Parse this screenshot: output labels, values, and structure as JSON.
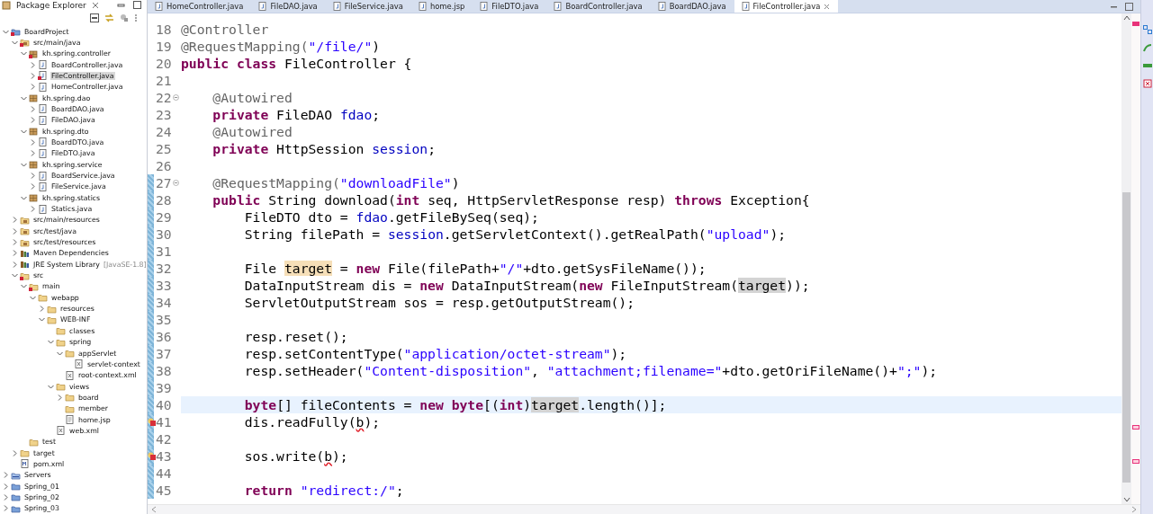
{
  "explorer": {
    "title": "Package Explorer",
    "tree": [
      {
        "label": "BoardProject",
        "kind": "project",
        "expanded": true,
        "error": true,
        "selected": false,
        "children": [
          {
            "label": "src/main/java",
            "kind": "source",
            "expanded": true,
            "error": true,
            "selected": false,
            "children": [
              {
                "label": "kh.spring.controller",
                "kind": "package",
                "expanded": true,
                "error": true,
                "selected": false,
                "children": [
                  {
                    "label": "BoardController.java",
                    "kind": "java",
                    "expanded": false,
                    "selected": false
                  },
                  {
                    "label": "FileController.java",
                    "kind": "java",
                    "expanded": false,
                    "error": true,
                    "selected": true
                  },
                  {
                    "label": "HomeController.java",
                    "kind": "java",
                    "expanded": false,
                    "selected": false
                  }
                ]
              },
              {
                "label": "kh.spring.dao",
                "kind": "package",
                "expanded": true,
                "selected": false,
                "children": [
                  {
                    "label": "BoardDAO.java",
                    "kind": "java",
                    "expanded": false,
                    "selected": false
                  },
                  {
                    "label": "FileDAO.java",
                    "kind": "java",
                    "expanded": false,
                    "selected": false
                  }
                ]
              },
              {
                "label": "kh.spring.dto",
                "kind": "package",
                "expanded": true,
                "selected": false,
                "children": [
                  {
                    "label": "BoardDTO.java",
                    "kind": "java",
                    "expanded": false,
                    "selected": false
                  },
                  {
                    "label": "FileDTO.java",
                    "kind": "java",
                    "expanded": false,
                    "selected": false
                  }
                ]
              },
              {
                "label": "kh.spring.service",
                "kind": "package",
                "expanded": true,
                "selected": false,
                "children": [
                  {
                    "label": "BoardService.java",
                    "kind": "java",
                    "expanded": false,
                    "selected": false
                  },
                  {
                    "label": "FileService.java",
                    "kind": "java",
                    "expanded": false,
                    "selected": false
                  }
                ]
              },
              {
                "label": "kh.spring.statics",
                "kind": "package",
                "expanded": true,
                "selected": false,
                "children": [
                  {
                    "label": "Statics.java",
                    "kind": "java",
                    "expanded": false,
                    "selected": false
                  }
                ]
              }
            ]
          },
          {
            "label": "src/main/resources",
            "kind": "source",
            "expanded": false,
            "selected": false
          },
          {
            "label": "src/test/java",
            "kind": "source",
            "expanded": false,
            "selected": false
          },
          {
            "label": "src/test/resources",
            "kind": "source",
            "expanded": false,
            "selected": false
          },
          {
            "label": "Maven Dependencies",
            "kind": "library",
            "expanded": false,
            "selected": false
          },
          {
            "label": "JRE System Library",
            "suffix": "[JavaSE-1.8]",
            "kind": "library",
            "expanded": false,
            "selected": false
          },
          {
            "label": "src",
            "kind": "folder",
            "expanded": true,
            "error": true,
            "selected": false,
            "children": [
              {
                "label": "main",
                "kind": "folder",
                "expanded": true,
                "error": true,
                "selected": false,
                "children": [
                  {
                    "label": "webapp",
                    "kind": "folder",
                    "expanded": true,
                    "selected": false,
                    "children": [
                      {
                        "label": "resources",
                        "kind": "folder",
                        "expanded": false,
                        "selected": false
                      },
                      {
                        "label": "WEB-INF",
                        "kind": "folder",
                        "expanded": true,
                        "selected": false,
                        "children": [
                          {
                            "label": "classes",
                            "kind": "folder",
                            "selected": false
                          },
                          {
                            "label": "spring",
                            "kind": "folder",
                            "expanded": true,
                            "selected": false,
                            "children": [
                              {
                                "label": "appServlet",
                                "kind": "folder",
                                "expanded": true,
                                "selected": false,
                                "children": [
                                  {
                                    "label": "servlet-context",
                                    "kind": "xml",
                                    "selected": false
                                  }
                                ]
                              },
                              {
                                "label": "root-context.xml",
                                "kind": "xml",
                                "selected": false
                              }
                            ]
                          },
                          {
                            "label": "views",
                            "kind": "folder",
                            "expanded": true,
                            "selected": false,
                            "children": [
                              {
                                "label": "board",
                                "kind": "folder",
                                "expanded": false,
                                "selected": false
                              },
                              {
                                "label": "member",
                                "kind": "folder",
                                "selected": false
                              },
                              {
                                "label": "home.jsp",
                                "kind": "jsp",
                                "selected": false
                              }
                            ]
                          },
                          {
                            "label": "web.xml",
                            "kind": "xml",
                            "selected": false
                          }
                        ]
                      }
                    ]
                  }
                ]
              },
              {
                "label": "test",
                "kind": "folder",
                "selected": false
              }
            ]
          },
          {
            "label": "target",
            "kind": "folder",
            "expanded": false,
            "selected": false
          },
          {
            "label": "pom.xml",
            "kind": "pom",
            "selected": false
          }
        ]
      },
      {
        "label": "Servers",
        "kind": "servers",
        "expanded": false,
        "selected": false
      },
      {
        "label": "Spring_01",
        "kind": "project",
        "expanded": false,
        "selected": false
      },
      {
        "label": "Spring_02",
        "kind": "project",
        "expanded": false,
        "selected": false
      },
      {
        "label": "Spring_03",
        "kind": "project",
        "expanded": false,
        "selected": false
      }
    ]
  },
  "tabs": [
    {
      "label": "HomeController.java",
      "selected": false
    },
    {
      "label": "FileDAO.java",
      "selected": false
    },
    {
      "label": "FileService.java",
      "selected": false
    },
    {
      "label": "home.jsp",
      "selected": false
    },
    {
      "label": "FileDTO.java",
      "selected": false
    },
    {
      "label": "BoardController.java",
      "selected": false
    },
    {
      "label": "BoardDAO.java",
      "selected": false
    },
    {
      "label": "FileController.java",
      "selected": true
    }
  ],
  "lines": [
    {
      "num": "18",
      "changed": false,
      "tokens": [
        {
          "text": "@Controller",
          "kind": "ann"
        }
      ]
    },
    {
      "num": "19",
      "changed": false,
      "tokens": [
        {
          "text": "@RequestMapping(",
          "kind": "ann"
        },
        {
          "text": "\"/file/\"",
          "kind": "str"
        },
        {
          "text": ")",
          "kind": "p"
        }
      ]
    },
    {
      "num": "20",
      "changed": false,
      "tokens": [
        {
          "text": "public class",
          "kind": "kw"
        },
        {
          "text": " FileController {",
          "kind": "p"
        }
      ]
    },
    {
      "num": "21",
      "changed": false
    },
    {
      "num": "22",
      "changed": false,
      "fold": true,
      "tokens": [
        {
          "text": "    @Autowired",
          "kind": "ann"
        }
      ]
    },
    {
      "num": "23",
      "changed": false,
      "tokens": [
        {
          "text": "    private",
          "kind": "kw"
        },
        {
          "text": " FileDAO ",
          "kind": "p"
        },
        {
          "text": "fdao",
          "kind": "fld"
        },
        {
          "text": ";",
          "kind": "p"
        }
      ]
    },
    {
      "num": "24",
      "changed": false,
      "tokens": [
        {
          "text": "    @Autowired",
          "kind": "ann"
        }
      ]
    },
    {
      "num": "25",
      "changed": false,
      "tokens": [
        {
          "text": "    private",
          "kind": "kw"
        },
        {
          "text": " HttpSession ",
          "kind": "p"
        },
        {
          "text": "session",
          "kind": "fld"
        },
        {
          "text": ";",
          "kind": "p"
        }
      ]
    },
    {
      "num": "26",
      "changed": false
    },
    {
      "num": "27",
      "changed": true,
      "fold": true,
      "tokens": [
        {
          "text": "    @RequestMapping(",
          "kind": "ann"
        },
        {
          "text": "\"downloadFile\"",
          "kind": "str"
        },
        {
          "text": ")",
          "kind": "p"
        }
      ]
    },
    {
      "num": "28",
      "changed": true,
      "tokens": [
        {
          "text": "    public",
          "kind": "kw"
        },
        {
          "text": " String download(",
          "kind": "p"
        },
        {
          "text": "int",
          "kind": "kw"
        },
        {
          "text": " seq, HttpServletResponse resp) ",
          "kind": "p"
        },
        {
          "text": "throws",
          "kind": "kw"
        },
        {
          "text": " Exception{",
          "kind": "p"
        }
      ]
    },
    {
      "num": "29",
      "changed": true,
      "tokens": [
        {
          "text": "        FileDTO dto = ",
          "kind": "p"
        },
        {
          "text": "fdao",
          "kind": "fld"
        },
        {
          "text": ".getFileBySeq(seq);",
          "kind": "p"
        }
      ]
    },
    {
      "num": "30",
      "changed": true,
      "tokens": [
        {
          "text": "        String filePath = ",
          "kind": "p"
        },
        {
          "text": "session",
          "kind": "fld"
        },
        {
          "text": ".getServletContext().getRealPath(",
          "kind": "p"
        },
        {
          "text": "\"upload\"",
          "kind": "str"
        },
        {
          "text": ");",
          "kind": "p"
        }
      ]
    },
    {
      "num": "31",
      "changed": true
    },
    {
      "num": "32",
      "changed": true,
      "tokens": [
        {
          "text": "        File ",
          "kind": "p"
        },
        {
          "text": "target",
          "kind": "write"
        },
        {
          "text": " = ",
          "kind": "p"
        },
        {
          "text": "new",
          "kind": "kw"
        },
        {
          "text": " File(filePath+",
          "kind": "p"
        },
        {
          "text": "\"/\"",
          "kind": "str"
        },
        {
          "text": "+dto.getSysFileName());",
          "kind": "p"
        }
      ]
    },
    {
      "num": "33",
      "changed": true,
      "tokens": [
        {
          "text": "        DataInputStream dis = ",
          "kind": "p"
        },
        {
          "text": "new",
          "kind": "kw"
        },
        {
          "text": " DataInputStream(",
          "kind": "p"
        },
        {
          "text": "new",
          "kind": "kw"
        },
        {
          "text": " FileInputStream(",
          "kind": "p"
        },
        {
          "text": "target",
          "kind": "read"
        },
        {
          "text": "));",
          "kind": "p"
        }
      ]
    },
    {
      "num": "34",
      "changed": true,
      "tokens": [
        {
          "text": "        ServletOutputStream sos = resp.getOutputStream();",
          "kind": "p"
        }
      ]
    },
    {
      "num": "35",
      "changed": true
    },
    {
      "num": "36",
      "changed": true,
      "tokens": [
        {
          "text": "        resp.reset();",
          "kind": "p"
        }
      ]
    },
    {
      "num": "37",
      "changed": true,
      "tokens": [
        {
          "text": "        resp.setContentType(",
          "kind": "p"
        },
        {
          "text": "\"application/octet-stream\"",
          "kind": "str"
        },
        {
          "text": ");",
          "kind": "p"
        }
      ]
    },
    {
      "num": "38",
      "changed": true,
      "tokens": [
        {
          "text": "        resp.setHeader(",
          "kind": "p"
        },
        {
          "text": "\"Content-disposition\"",
          "kind": "str"
        },
        {
          "text": ", ",
          "kind": "p"
        },
        {
          "text": "\"attachment;filename=\"",
          "kind": "str"
        },
        {
          "text": "+dto.getOriFileName()+",
          "kind": "p"
        },
        {
          "text": "\";\"",
          "kind": "str"
        },
        {
          "text": ");",
          "kind": "p"
        }
      ]
    },
    {
      "num": "39",
      "changed": true
    },
    {
      "num": "40",
      "changed": true,
      "current": true,
      "tokens": [
        {
          "text": "        byte",
          "kind": "kw"
        },
        {
          "text": "[] fileContents = ",
          "kind": "p"
        },
        {
          "text": "new byte",
          "kind": "kw"
        },
        {
          "text": "[(",
          "kind": "p"
        },
        {
          "text": "int",
          "kind": "kw"
        },
        {
          "text": ")",
          "kind": "p"
        },
        {
          "text": "target",
          "kind": "read"
        },
        {
          "text": ".length()];",
          "kind": "p"
        }
      ]
    },
    {
      "num": "41",
      "changed": true,
      "error": true,
      "tokens": [
        {
          "text": "        dis.readFully(",
          "kind": "p"
        },
        {
          "text": "b",
          "kind": "err"
        },
        {
          "text": ");",
          "kind": "p"
        }
      ]
    },
    {
      "num": "42",
      "changed": true
    },
    {
      "num": "43",
      "changed": true,
      "error": true,
      "tokens": [
        {
          "text": "        sos.write(",
          "kind": "p"
        },
        {
          "text": "b",
          "kind": "err"
        },
        {
          "text": ");",
          "kind": "p"
        }
      ]
    },
    {
      "num": "44",
      "changed": true
    },
    {
      "num": "45",
      "changed": true,
      "tokens": [
        {
          "text": "        return",
          "kind": "kw"
        },
        {
          "text": " \"redirect:/\"",
          "kind": "str"
        },
        {
          "text": ";",
          "kind": "p"
        }
      ]
    }
  ]
}
